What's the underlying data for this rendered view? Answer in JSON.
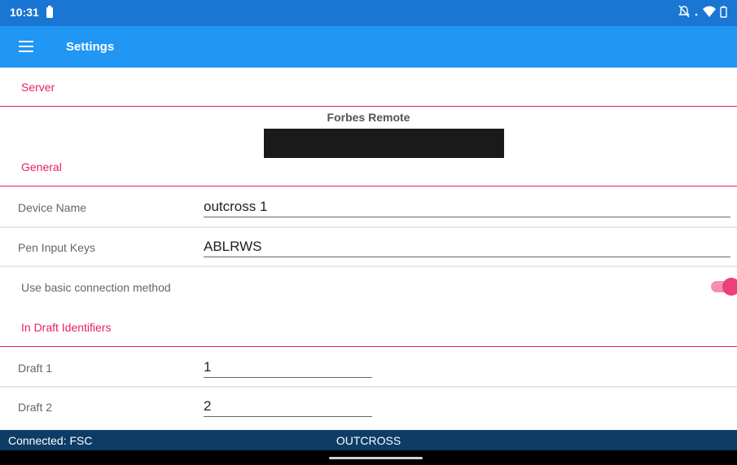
{
  "status_bar": {
    "time": "10:31"
  },
  "app_bar": {
    "title": "Settings"
  },
  "sections": {
    "server": "Server",
    "general": "General",
    "draft_identifiers": "In Draft Identifiers"
  },
  "server": {
    "name": "Forbes Remote"
  },
  "general": {
    "device_name_label": "Device Name",
    "device_name_value": "outcross 1",
    "pen_input_keys_label": "Pen Input Keys",
    "pen_input_keys_value": "ABLRWS",
    "basic_connection_label": "Use basic connection method",
    "basic_connection_enabled": true
  },
  "drafts": [
    {
      "label": "Draft 1",
      "value": "1"
    },
    {
      "label": "Draft 2",
      "value": "2"
    }
  ],
  "bottom_bar": {
    "connection_status": "Connected: FSC",
    "device": "OUTCROSS"
  },
  "colors": {
    "status_bar": "#1976D2",
    "app_bar": "#2196F3",
    "accent": "#E91E63",
    "bottom_bar": "#0D3D66"
  },
  "icons": {
    "menu": "menu-icon",
    "battery": "battery-icon",
    "notifications_off": "notifications-off-icon",
    "wifi": "wifi-icon"
  }
}
